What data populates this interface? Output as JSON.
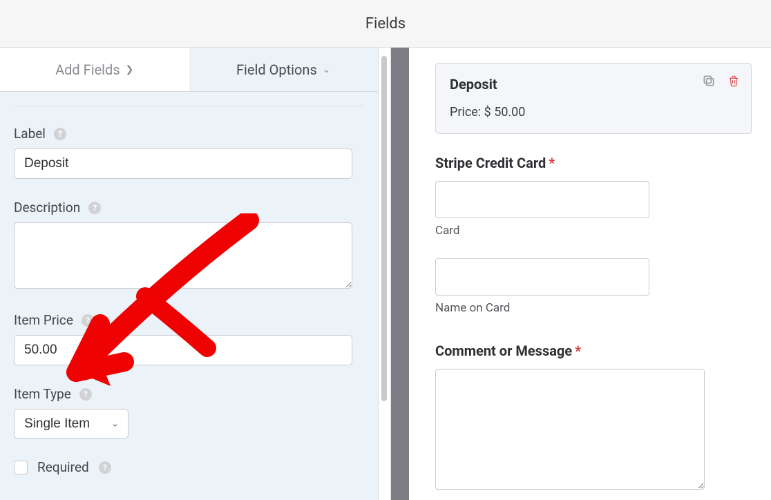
{
  "header": {
    "title": "Fields"
  },
  "tabs": {
    "add": "Add Fields",
    "options": "Field Options"
  },
  "options": {
    "label_heading": "Label",
    "label_value": "Deposit",
    "description_heading": "Description",
    "description_value": "",
    "item_price_heading": "Item Price",
    "item_price_value": "50.00",
    "item_type_heading": "Item Type",
    "item_type_value": "Single Item",
    "required_label": "Required"
  },
  "preview": {
    "card_title": "Deposit",
    "card_price": "Price: $ 50.00",
    "stripe_label": "Stripe Credit Card",
    "card_sub": "Card",
    "name_sub": "Name on Card",
    "comment_label": "Comment or Message"
  }
}
